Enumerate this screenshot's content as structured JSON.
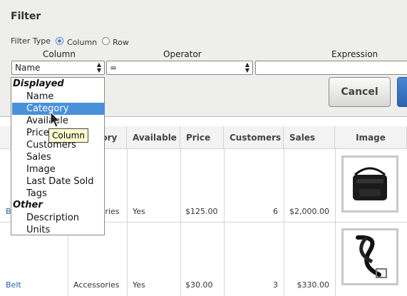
{
  "filter": {
    "title": "Filter",
    "filter_type_label": "Filter Type",
    "radio_column": "Column",
    "radio_row": "Row",
    "header_column": "Column",
    "header_operator": "Operator",
    "header_expression": "Expression",
    "column_value": "Name",
    "operator_value": "=",
    "expression_value": "",
    "cancel_label": "Cancel",
    "ok_label": ""
  },
  "dropdown": {
    "group_displayed": "Displayed",
    "displayed_items": [
      "Name",
      "Category",
      "Available",
      "Price",
      "Customers",
      "Sales",
      "Image",
      "Last Date Sold",
      "Tags"
    ],
    "group_other": "Other",
    "other_items": [
      "Description",
      "Units"
    ],
    "selected": "Category"
  },
  "tooltip": "Column",
  "table": {
    "headers": [
      "Category",
      "Available",
      "Price",
      "Customers",
      "Sales",
      "Image"
    ],
    "rows": [
      {
        "name": "Bag",
        "category": "Accessories",
        "available": "Yes",
        "price": "$125.00",
        "customers": "6",
        "sales": "$2,000.00",
        "image": "bag-image"
      },
      {
        "name": "Belt",
        "category": "Accessories",
        "available": "Yes",
        "price": "$30.00",
        "customers": "3",
        "sales": "$330.00",
        "image": "belt-image"
      }
    ]
  },
  "colors": {
    "accent": "#4a90d9",
    "link": "#2a5db0",
    "tooltip_bg": "#ffffd0"
  }
}
